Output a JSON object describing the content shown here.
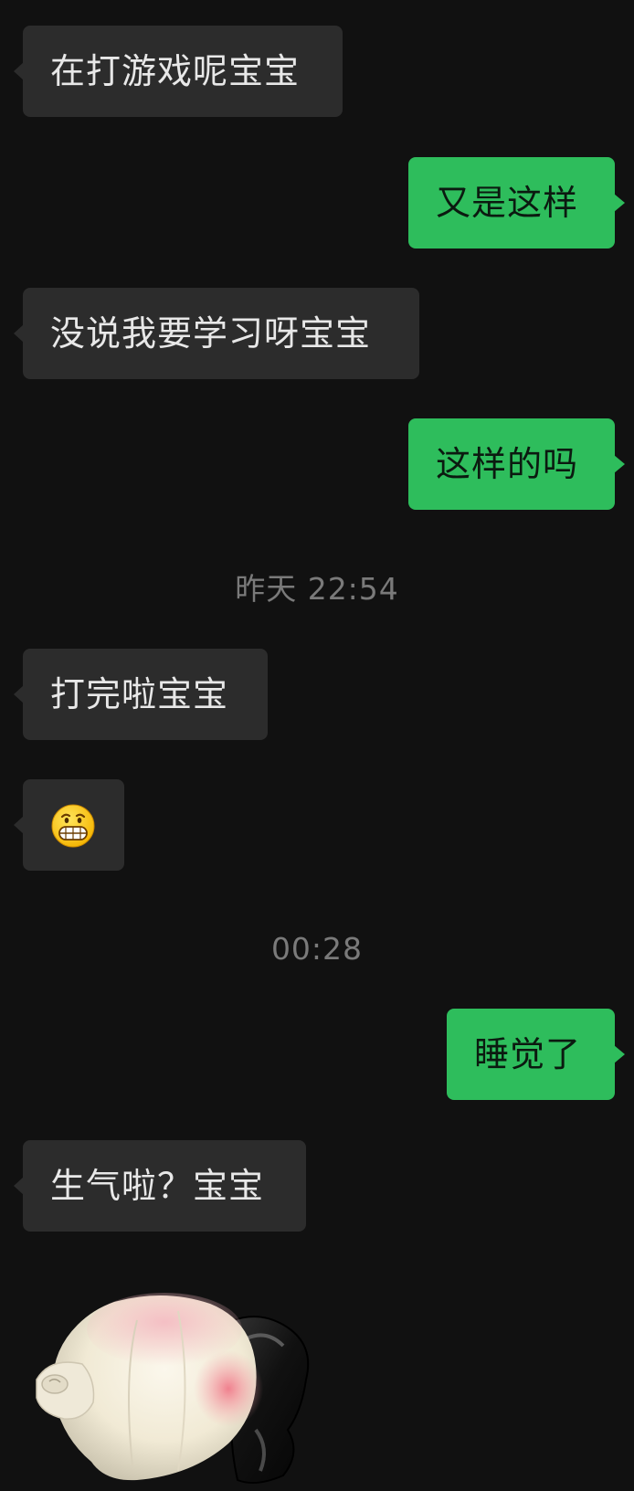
{
  "messages": [
    {
      "side": "in",
      "text": "在打游戏呢宝宝"
    },
    {
      "side": "out",
      "text": "又是这样"
    },
    {
      "side": "in",
      "text": "没说我要学习呀宝宝"
    },
    {
      "side": "out",
      "text": "这样的吗"
    },
    {
      "side": "in",
      "text": "打完啦宝宝"
    },
    {
      "side": "in",
      "emoji": "grinning-face-icon"
    },
    {
      "side": "out",
      "text": "睡觉了"
    },
    {
      "side": "in",
      "text": "生气啦？宝宝"
    },
    {
      "side": "in",
      "sticker": "garlic-bulb-sticker"
    }
  ],
  "timestamps": [
    "昨天 22:54",
    "00:28"
  ],
  "colors": {
    "background": "#111111",
    "incoming_bubble": "#2c2c2c",
    "outgoing_bubble": "#2ebd5c",
    "timestamp_text": "#7a7a7a"
  }
}
